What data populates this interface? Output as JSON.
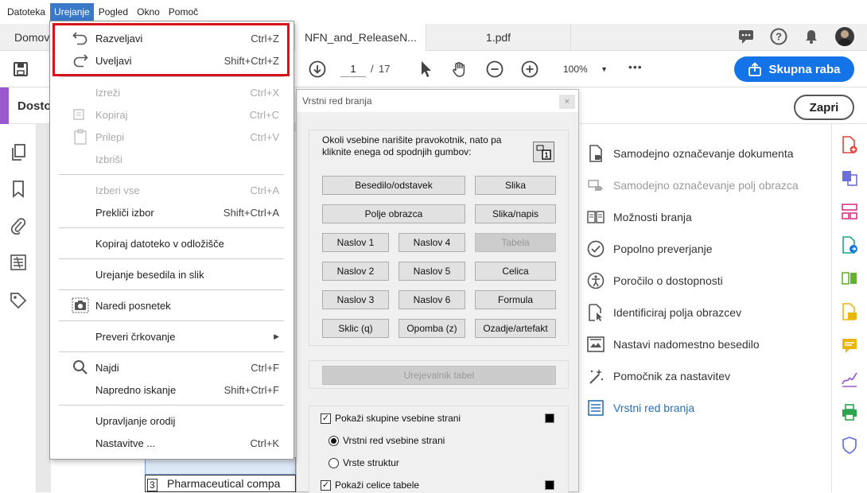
{
  "menubar": {
    "items": [
      "Datoteka",
      "Urejanje",
      "Pogled",
      "Okno",
      "Pomoč"
    ]
  },
  "tabs": {
    "home": "Domov",
    "doc1": "NFN_and_ReleaseN...",
    "doc2": "1.pdf"
  },
  "toolbar": {
    "page_current": "1",
    "page_sep": "/",
    "page_total": "17",
    "zoom": "100%",
    "share": "Skupna raba",
    "more": "•••"
  },
  "subbar": {
    "title": "Dosto",
    "close": "Zapri"
  },
  "menu": {
    "undo": {
      "label": "Razveljavi",
      "shortcut": "Ctrl+Z"
    },
    "redo": {
      "label": "Uveljavi",
      "shortcut": "Shift+Ctrl+Z"
    },
    "cut": {
      "label": "Izreži",
      "shortcut": "Ctrl+X"
    },
    "copy": {
      "label": "Kopiraj",
      "shortcut": "Ctrl+C"
    },
    "paste": {
      "label": "Prilepi",
      "shortcut": "Ctrl+V"
    },
    "delete": {
      "label": "Izbriši",
      "shortcut": ""
    },
    "select_all": {
      "label": "Izberi vse",
      "shortcut": "Ctrl+A"
    },
    "deselect": {
      "label": "Prekliči izbor",
      "shortcut": "Shift+Ctrl+A"
    },
    "copy_file": {
      "label": "Kopiraj datoteko v odložišče",
      "shortcut": ""
    },
    "edit_text": {
      "label": "Urejanje besedila in slik",
      "shortcut": ""
    },
    "snapshot": {
      "label": "Naredi posnetek",
      "shortcut": ""
    },
    "spell": {
      "label": "Preveri črkovanje",
      "shortcut": ""
    },
    "find": {
      "label": "Najdi",
      "shortcut": "Ctrl+F"
    },
    "adv_search": {
      "label": "Napredno iskanje",
      "shortcut": "Shift+Ctrl+F"
    },
    "manage_tools": {
      "label": "Upravljanje orodij",
      "shortcut": ""
    },
    "prefs": {
      "label": "Nastavitve ...",
      "shortcut": "Ctrl+K"
    }
  },
  "dialog": {
    "title": "Vrstni red branja",
    "close": "×",
    "instruction": "Okoli vsebine narišite pravokotnik, nato pa kliknite enega od spodnjih gumbov:",
    "buttons": {
      "text": "Besedilo/odstavek",
      "figure": "Slika",
      "form": "Polje obrazca",
      "figcap": "Slika/napis",
      "h1": "Naslov 1",
      "h4": "Naslov 4",
      "table": "Tabela",
      "h2": "Naslov 2",
      "h5": "Naslov 5",
      "cell": "Celica",
      "h3": "Naslov 3",
      "h6": "Naslov 6",
      "formula": "Formula",
      "ref": "Sklic (q)",
      "note": "Opomba (z)",
      "bg": "Ozadje/artefakt"
    },
    "table_editor": "Urejevalnik tabel",
    "show_groups": "Pokaži skupine vsebine strani",
    "order": "Vrstni red vsebine strani",
    "structure": "Vrste struktur",
    "show_cells": "Pokaži celice tabele"
  },
  "right_panel": {
    "items": [
      "Samodejno označevanje dokumenta",
      "Samodejno označevanje polj obrazca",
      "Možnosti branja",
      "Popolno preverjanje",
      "Poročilo o dostopnosti",
      "Identificiraj polja obrazcev",
      "Nastavi nadomestno besedilo",
      "Pomočnik za nastavitev",
      "Vrstni red branja"
    ]
  },
  "document": {
    "heading_num": "3",
    "heading_text": "Pharmaceutical compa"
  },
  "colors": {
    "accent": "#1473e6",
    "highlight": "#d8121a",
    "link": "#2a6fb8"
  }
}
